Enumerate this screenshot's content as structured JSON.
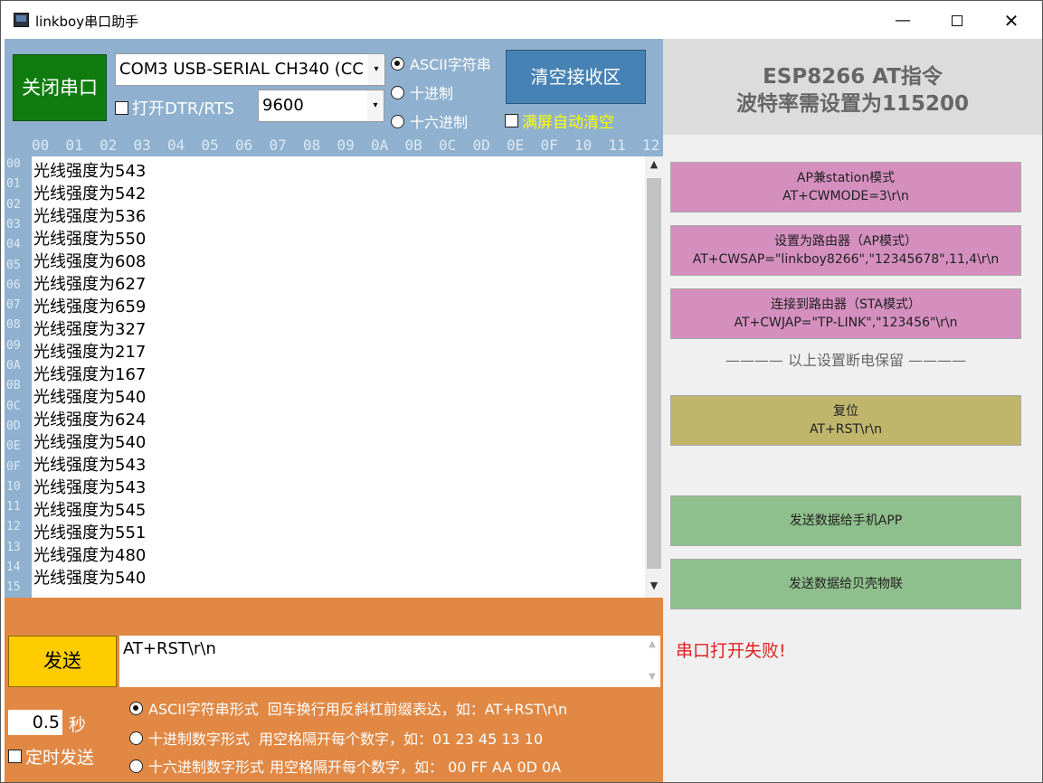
{
  "window": {
    "title": "linkboy串口助手",
    "minimize": "—",
    "close": "✕"
  },
  "port_controls": {
    "close_port_button": "关闭串口",
    "port_selected": "COM3 USB-SERIAL CH340 (CC",
    "baud_selected": "9600",
    "dtr_rts_label": "打开DTR/RTS",
    "dropdown_arrow": "▾",
    "receive_format": {
      "ascii": "ASCII字符串",
      "decimal": "十进制",
      "hex": "十六进制",
      "selected": "ascii"
    },
    "clear_button": "清空接收区",
    "auto_clear_label": "满屏自动清空"
  },
  "hex_header": [
    "00",
    "01",
    "02",
    "03",
    "04",
    "05",
    "06",
    "07",
    "08",
    "09",
    "0A",
    "0B",
    "0C",
    "0D",
    "0E",
    "0F",
    "10",
    "11",
    "12"
  ],
  "row_numbers": [
    "00",
    "01",
    "02",
    "03",
    "04",
    "05",
    "06",
    "07",
    "08",
    "09",
    "0A",
    "0B",
    "0C",
    "0D",
    "0E",
    "0F",
    "10",
    "11",
    "12",
    "13",
    "14",
    "15"
  ],
  "receive_lines": [
    "光线强度为543",
    "光线强度为542",
    "光线强度为536",
    "光线强度为550",
    "光线强度为608",
    "光线强度为627",
    "光线强度为659",
    "光线强度为327",
    "光线强度为217",
    "光线强度为167",
    "光线强度为540",
    "光线强度为624",
    "光线强度为540",
    "光线强度为543",
    "光线强度为543",
    "光线强度为545",
    "光线强度为551",
    "光线强度为480",
    "光线强度为540"
  ],
  "send": {
    "button": "发送",
    "input_value": "AT+RST\\r\\n",
    "interval_value": "0.5",
    "interval_unit": "秒",
    "timer_label": "定时发送",
    "formats": [
      {
        "name": "ASCII字符串形式",
        "hint": "回车换行用反斜杠前缀表达，如：AT+RST\\r\\n",
        "selected": true
      },
      {
        "name": "十进制数字形式",
        "hint": "用空格隔开每个数字，如：01 23 45 13 10",
        "selected": false
      },
      {
        "name": "十六进制数字形式",
        "hint": "用空格隔开每个数字，如：  00 FF AA 0D 0A",
        "selected": false
      }
    ]
  },
  "right_panel": {
    "title": "ESP8266  AT指令",
    "subtitle": "波特率需设置为115200",
    "commands": [
      {
        "label": "AP兼station模式",
        "cmd": "AT+CWMODE=3\\r\\n",
        "color": "#d48fbf"
      },
      {
        "label": "设置为路由器（AP模式）",
        "cmd": "AT+CWSAP=\"linkboy8266\",\"12345678\",11,4\\r\\n",
        "color": "#d48fbf"
      },
      {
        "label": "连接到路由器（STA模式）",
        "cmd": "AT+CWJAP=\"TP-LINK\",\"123456\"\\r\\n",
        "color": "#d48fbf"
      },
      {
        "label": "复位",
        "cmd": "AT+RST\\r\\n",
        "color": "#bfb66c"
      },
      {
        "label": "发送数据给手机APP",
        "cmd": "",
        "color": "#8fbf8c"
      },
      {
        "label": "发送数据给贝壳物联",
        "cmd": "",
        "color": "#8fbf8c"
      }
    ],
    "divider_note": "———— 以上设置断电保留 ————",
    "status_message": "串口打开失败!"
  },
  "colors": {
    "control_blue": "#8fb1cf",
    "send_orange": "#e08844",
    "close_port_green": "#107c10",
    "clear_blue": "#4682b4",
    "send_yellow": "#ffcc00",
    "error_red": "#e02020"
  },
  "icons": {
    "app": "app-window-icon",
    "scroll_up": "▲",
    "scroll_down": "▼",
    "send_scroll_up": "▲",
    "send_scroll_down": "▼"
  }
}
